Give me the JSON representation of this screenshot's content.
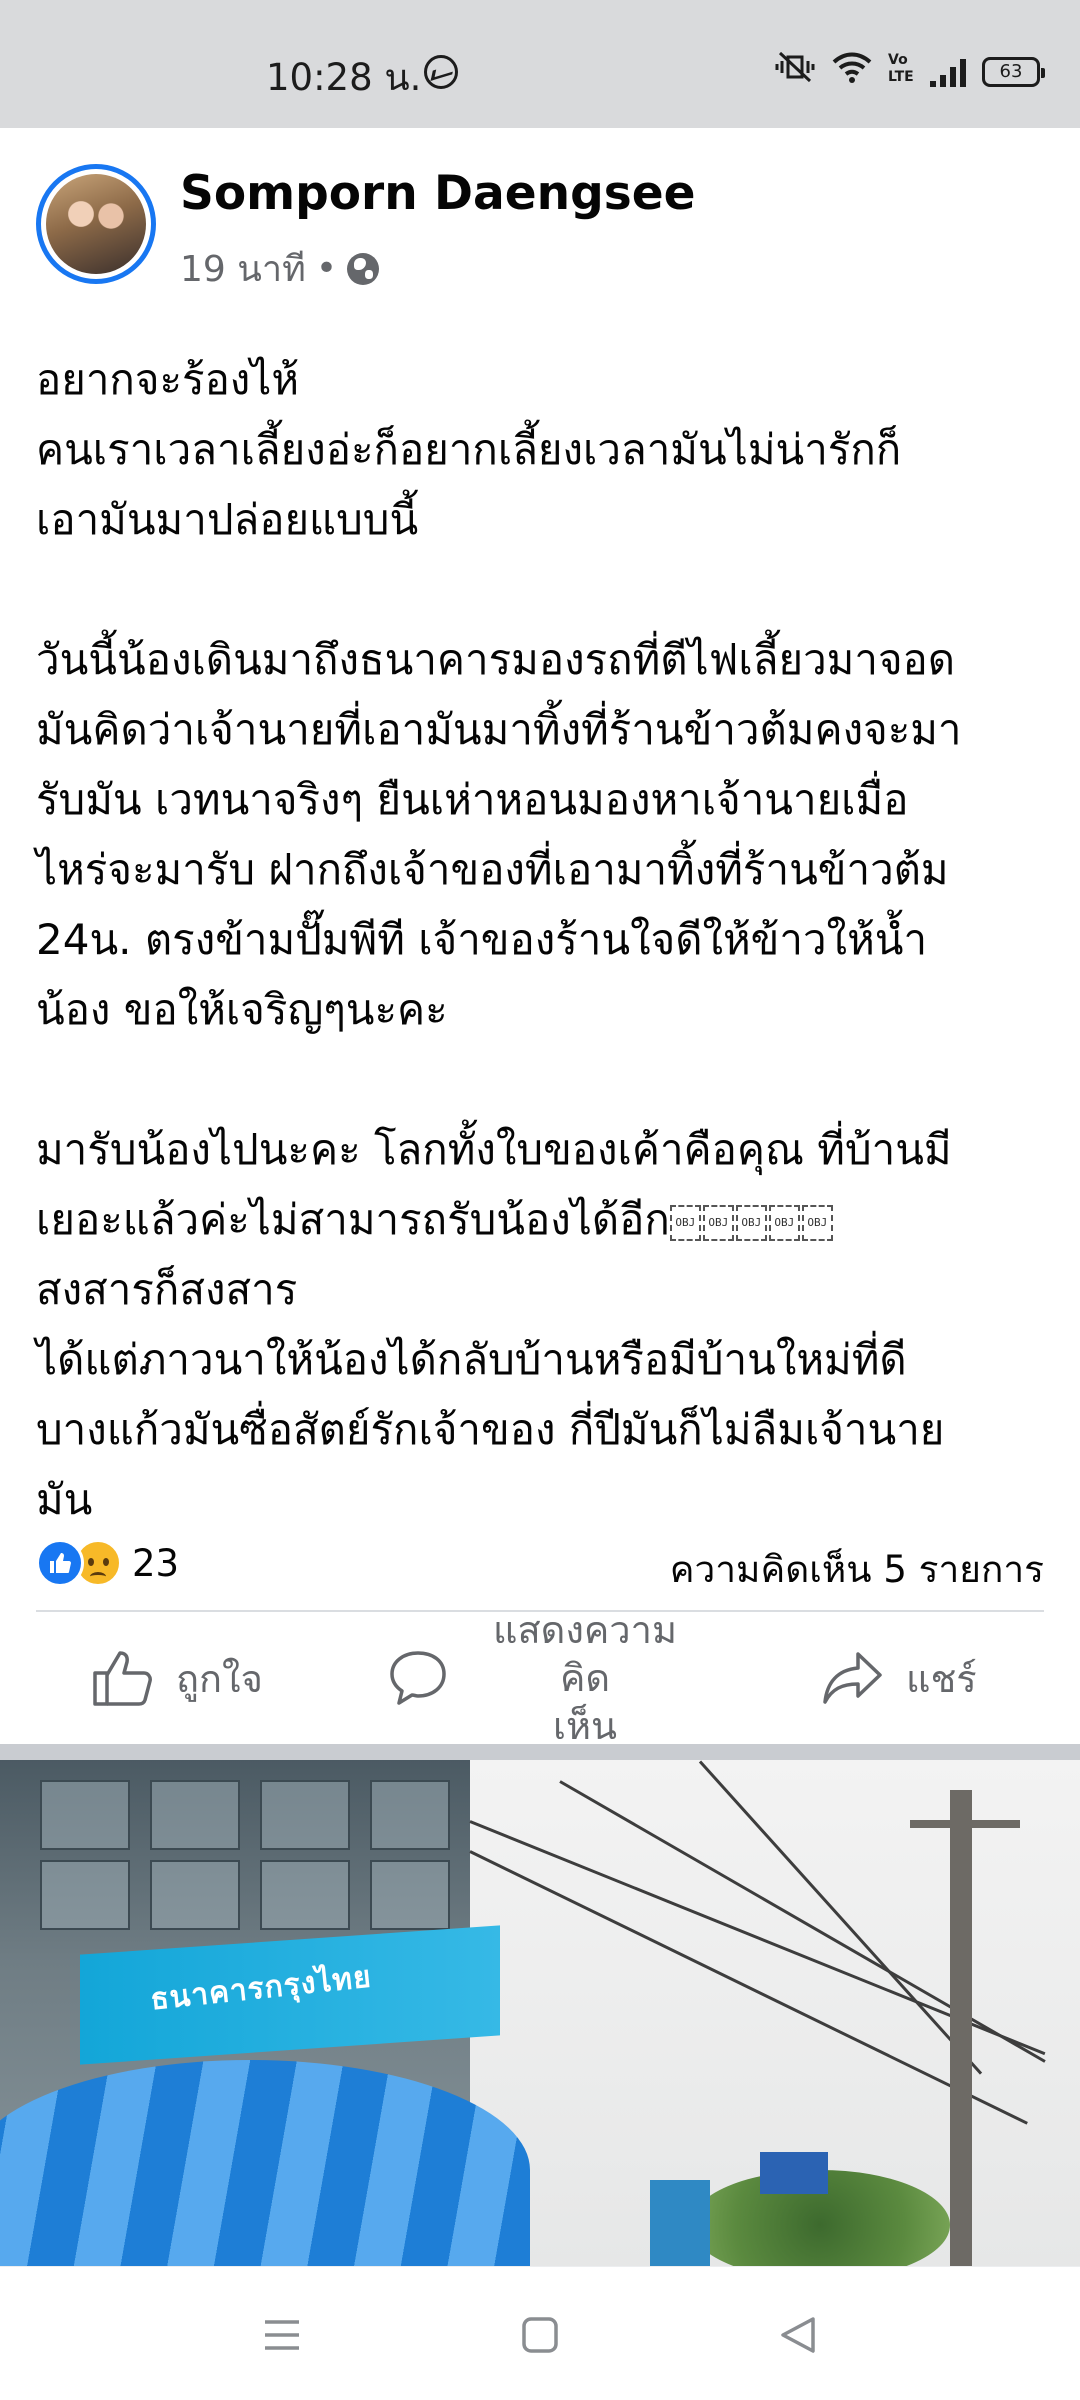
{
  "status_bar": {
    "time": "10:28 น.",
    "battery": "63"
  },
  "post": {
    "author": "Somporn Daengsee",
    "time_ago": "19 นาที",
    "separator": "•",
    "paragraphs": [
      [
        "อยากจะร้องไห้",
        "คนเราเวลาเลี้ยงอ่ะก็อยากเลี้ยงเวลามันไม่น่ารักก็",
        "เอามันมาปล่อยแบบนี้"
      ],
      [
        "วันนี้น้องเดินมาถึงธนาคารมองรถที่ตีไฟเลี้ยวมาจอด",
        "มันคิดว่าเจ้านายที่เอามันมาทิ้งที่ร้านข้าวต้มคงจะมา",
        "รับมัน เวทนาจริงๆ ยืนเห่าหอนมองหาเจ้านายเมื่อ",
        "ไหร่จะมารับ ฝากถึงเจ้าของที่เอามาทิ้งที่ร้านข้าวต้ม",
        "24น. ตรงข้ามปั๊มพีที เจ้าของร้านใจดีให้ข้าวให้น้ำ",
        "น้อง ขอให้เจริญๆนะคะ"
      ],
      [
        "มารับน้องไปนะคะ โลกทั้งใบของเค้าคือคุณ ที่บ้านมี",
        "เยอะแล้วค่ะไม่สามารถรับน้องได้อีก",
        "สงสารก็สงสาร",
        "ได้แต่ภาวนาให้น้องได้กลับบ้านหรือมีบ้านใหม่ที่ดี",
        "บางแก้วมันซื่อสัตย์รักเจ้าของ กี่ปีมันก็ไม่ลืมเจ้านาย",
        "มัน"
      ]
    ],
    "obj_glyph": "OBJ",
    "reaction_count": "23",
    "comment_count": "ความคิดเห็น 5 รายการ",
    "photo_sign": "ธนาคารกรุงไทย"
  },
  "actions": {
    "like": "ถูกใจ",
    "comment_line1": "แสดงความคิด",
    "comment_line2": "เห็น",
    "share": "แชร์"
  }
}
